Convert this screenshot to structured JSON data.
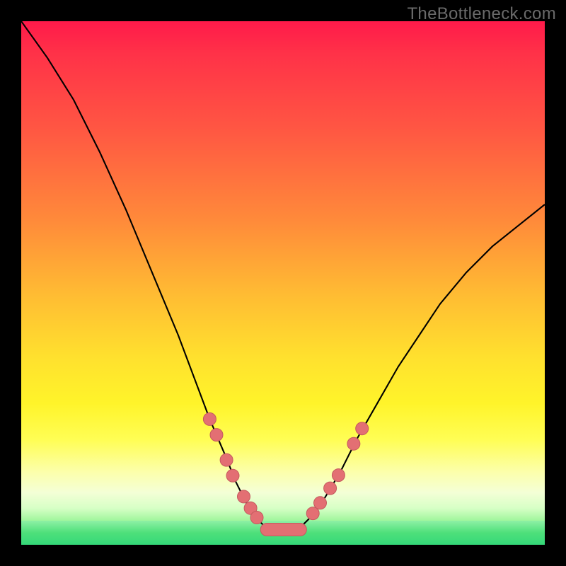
{
  "watermark": "TheBottleneck.com",
  "colors": {
    "frame": "#000000",
    "marker_fill": "#e36f73",
    "marker_stroke": "#c45a5e",
    "curve": "#000000",
    "gradient_top": "#ff1a4a",
    "gradient_bottom": "#35d879"
  },
  "chart_data": {
    "type": "line",
    "title": "",
    "xlabel": "",
    "ylabel": "",
    "xlim": [
      0,
      100
    ],
    "ylim": [
      0,
      100
    ],
    "grid": false,
    "legend": false,
    "x": [
      0,
      5,
      10,
      15,
      20,
      25,
      30,
      33,
      36,
      39,
      41,
      43,
      45,
      47,
      49,
      51,
      53,
      55,
      58,
      61,
      64,
      68,
      72,
      76,
      80,
      85,
      90,
      95,
      100
    ],
    "y": [
      100,
      93,
      85,
      75,
      64,
      52,
      40,
      32,
      24,
      17,
      12,
      8,
      5,
      3,
      2.5,
      2.5,
      3,
      5,
      9,
      14,
      20,
      27,
      34,
      40,
      46,
      52,
      57,
      61,
      65
    ],
    "note": "y is normalized bottleneck percentage (0 at bottom of plot area, 100 at top). Curve forms a V with minimum near x≈49–51, y≈2.5.",
    "markers": {
      "left_branch": [
        {
          "x": 36.0,
          "y": 24.0
        },
        {
          "x": 37.3,
          "y": 21.0
        },
        {
          "x": 39.2,
          "y": 16.2
        },
        {
          "x": 40.4,
          "y": 13.2
        },
        {
          "x": 42.5,
          "y": 9.2
        },
        {
          "x": 43.8,
          "y": 7.0
        },
        {
          "x": 45.0,
          "y": 5.2
        }
      ],
      "right_branch": [
        {
          "x": 55.7,
          "y": 6.0
        },
        {
          "x": 57.1,
          "y": 8.0
        },
        {
          "x": 59.0,
          "y": 10.8
        },
        {
          "x": 60.6,
          "y": 13.3
        },
        {
          "x": 63.5,
          "y": 19.3
        },
        {
          "x": 65.1,
          "y": 22.2
        }
      ],
      "bottom_pill": {
        "x_start": 45.7,
        "x_end": 54.5,
        "y": 2.9
      }
    }
  }
}
